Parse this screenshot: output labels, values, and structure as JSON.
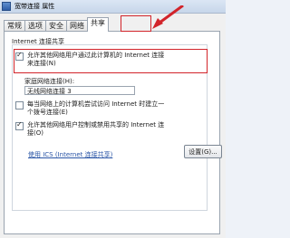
{
  "window": {
    "title": "宽带连接 属性"
  },
  "tabs": [
    "常规",
    "选项",
    "安全",
    "网络",
    "共享"
  ],
  "active_tab_index": 4,
  "group": {
    "title": "Internet 连接共享"
  },
  "options": {
    "allow_others": {
      "line1": "允许其他网络用户通过此计算机的 Internet 连接",
      "line2": "来连接(N)",
      "checked": true
    },
    "home_network_label": "家庭网络连接(H):",
    "home_network_value": "无线网络连接 3",
    "dial_on_demand": {
      "line1": "每当网络上的计算机尝试访问 Internet 时建立一",
      "line2": "个拨号连接(E)",
      "checked": false
    },
    "allow_control": {
      "line1": "允许其他网络用户控制或禁用共享的 Internet 连",
      "line2": "接(O)",
      "checked": true
    }
  },
  "link_text": "使用 ICS (Internet 连接共享)",
  "settings_button": "设置(G)..."
}
